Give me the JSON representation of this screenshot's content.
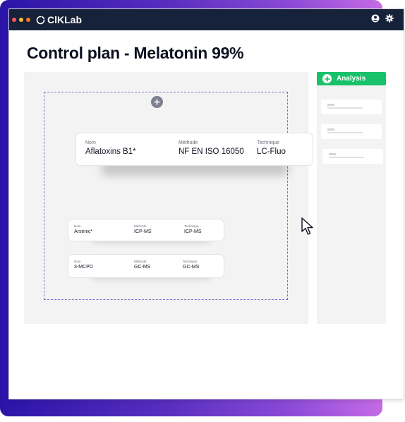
{
  "app": {
    "name": "ClKLab",
    "window_dots": [
      "#ff5a5a",
      "#ffbd2e",
      "#ff7a1a"
    ]
  },
  "page": {
    "title": "Control plan - Melatonin 99%"
  },
  "cards": [
    {
      "nom_label": "Nom",
      "nom": "Aflatoxins B1*",
      "methode_label": "Méthode",
      "methode": "NF EN ISO 16050",
      "technique_label": "Technique",
      "technique": "LC-Fluo"
    },
    {
      "nom_label": "Nom",
      "nom": "Arsenic*",
      "methode_label": "Méthode",
      "methode": "ICP-MS",
      "technique_label": "Technique",
      "technique": "ICP-MS"
    },
    {
      "nom_label": "Nom",
      "nom": "3-MCPD",
      "methode_label": "Méthode",
      "methode": "GC-MS",
      "technique_label": "Technique",
      "technique": "GC-MS"
    }
  ],
  "sidebar": {
    "add_button_label": "Analysis",
    "accent": "#19c26a"
  },
  "icons": {
    "user": "user-icon",
    "settings": "gear-icon",
    "add": "plus-icon",
    "cursor": "cursor-icon"
  }
}
